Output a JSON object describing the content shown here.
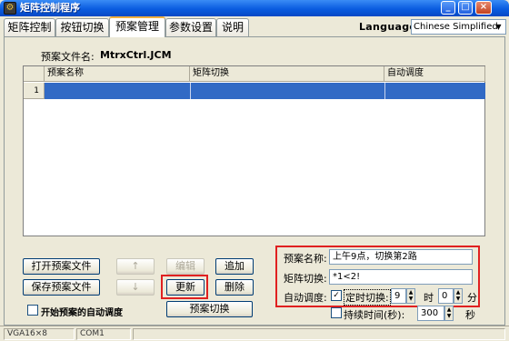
{
  "window": {
    "title": "矩阵控制程序"
  },
  "tabs": [
    {
      "label": "矩阵控制"
    },
    {
      "label": "按钮切换"
    },
    {
      "label": "预案管理"
    },
    {
      "label": "参数设置"
    },
    {
      "label": "说明"
    }
  ],
  "language": {
    "label": "Language:",
    "value": "Chinese Simplified"
  },
  "plan_file": {
    "label": "预案文件名:",
    "value": "MtrxCtrl.JCM"
  },
  "grid": {
    "columns": [
      "预案名称",
      "矩阵切换",
      "自动调度"
    ],
    "rows": [
      {
        "num": "1"
      }
    ]
  },
  "buttons": {
    "open": "打开预案文件",
    "save": "保存预案文件",
    "up": "↑",
    "down": "↓",
    "edit": "编辑",
    "add": "追加",
    "update": "更新",
    "delete": "删除",
    "switch": "预案切换"
  },
  "auto_start": {
    "label": "开始预案的自动调度",
    "checked": false
  },
  "detail": {
    "name_label": "预案名称:",
    "name_value": "上午9点，切换第2路",
    "switch_label": "矩阵切换:",
    "switch_value": "*1<2!",
    "auto_label": "自动调度:",
    "timed_label": "定时切换:",
    "timed_checked": true,
    "hour_value": "9",
    "hour_unit": "时",
    "minute_value": "0",
    "minute_unit": "分",
    "duration_label": "持续时间(秒):",
    "duration_checked": false,
    "duration_value": "300",
    "duration_unit": "秒"
  },
  "status": {
    "cell1": "VGA16×8",
    "cell2": "COM1"
  },
  "colors": {
    "highlight": "#e02020",
    "selection": "#316ac5",
    "titlebar": "#0a5ce0"
  }
}
